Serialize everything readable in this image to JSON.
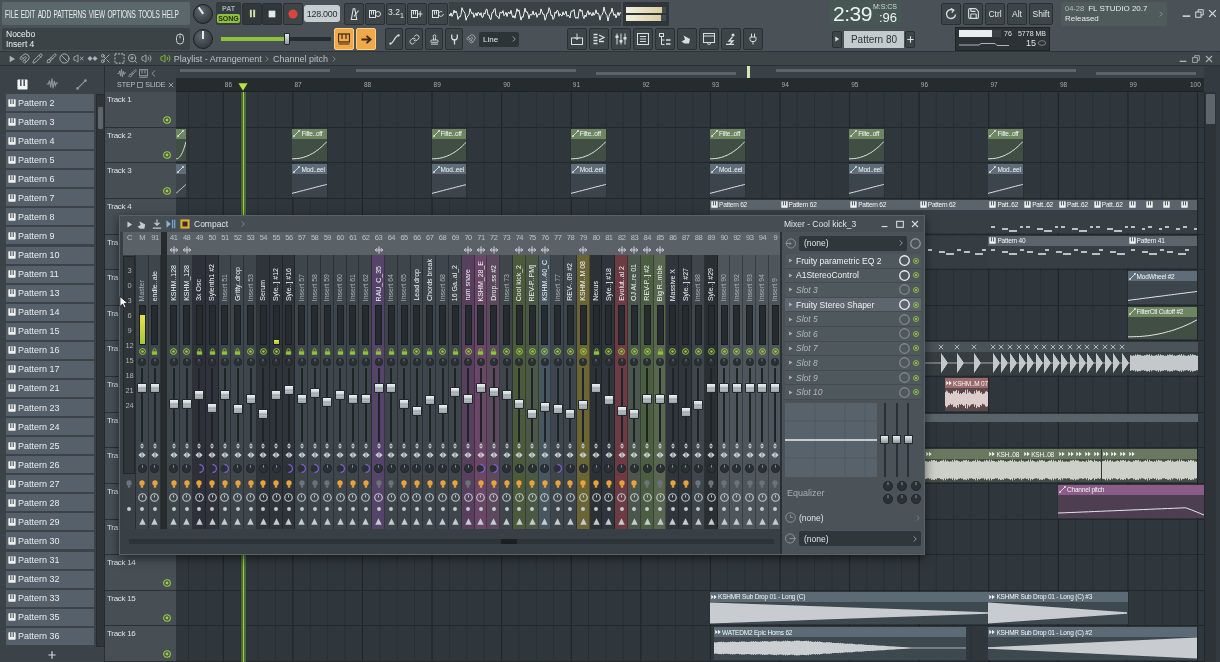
{
  "toolbar": {
    "menu": [
      "FILE",
      "EDIT",
      "ADD",
      "PATTERNS",
      "VIEW",
      "OPTIONS",
      "TOOLS",
      "HELP"
    ],
    "modes": [
      {
        "label": "PAT",
        "selected": false
      },
      {
        "label": "SONG",
        "selected": true
      }
    ],
    "playing": true,
    "recording": false,
    "tempo": "128.000",
    "countdown": "3.2$_{1}$",
    "output": [
      {
        "level": 0.9
      },
      {
        "level": 0.88
      }
    ],
    "time": "2:39",
    "time_sub": ":96",
    "time_unit": "M:S:CS",
    "keys": [
      "Ctrl",
      "Alt",
      "Shift"
    ],
    "news": {
      "date": "04-28",
      "title": "FL STUDIO 20.7",
      "text": "Released"
    },
    "hint": {
      "title": "Nocebo",
      "text": "Insert 4"
    },
    "slider": {
      "level": 0.6
    },
    "toggles": [
      {
        "kind": "keys",
        "on": true
      },
      {
        "kind": "arrow",
        "on": true
      }
    ],
    "snap": "Line",
    "pattern": "Pattern 80",
    "cpu": {
      "level": 0.78,
      "value": "76",
      "memory": "5778 MB",
      "polyphony": "15"
    }
  },
  "playlist": {
    "title": "Playlist - Arrangement",
    "clip": "Channel pitch",
    "picker_tabs": [
      {
        "kind": "patterns",
        "selected": true
      },
      {
        "kind": "audio",
        "selected": false
      },
      {
        "kind": "automation",
        "selected": false
      }
    ],
    "patterns": [
      "Pattern 2",
      "Pattern 3",
      "Pattern 4",
      "Pattern 5",
      "Pattern 6",
      "Pattern 7",
      "Pattern 8",
      "Pattern 9",
      "Pattern 10",
      "Pattern 11",
      "Pattern 13",
      "Pattern 14",
      "Pattern 15",
      "Pattern 16",
      "Pattern 17",
      "Pattern 21",
      "Pattern 23",
      "Pattern 24",
      "Pattern 25",
      "Pattern 26",
      "Pattern 27",
      "Pattern 28",
      "Pattern 29",
      "Pattern 30",
      "Pattern 31",
      "Pattern 32",
      "Pattern 33",
      "Pattern 35",
      "Pattern 36"
    ],
    "step": "STEP",
    "slide": "SLIDE",
    "bars": [
      "86",
      "87",
      "88",
      "89",
      "90",
      "91",
      "92",
      "93",
      "94",
      "95",
      "96",
      "97",
      "98",
      "99",
      "100"
    ],
    "tracks": [
      {
        "name": "Track 1",
        "enabled": true
      },
      {
        "name": "Track 2",
        "enabled": true,
        "clips": [
          {
            "kind": "automation",
            "color": "#6e8562"
          },
          {
            "kind": "automation",
            "label": "Filte..off",
            "color": "#6e8562"
          },
          {
            "kind": "automation",
            "label": "Filte..off",
            "color": "#6e8562"
          },
          {
            "kind": "automation",
            "label": "Filte..off",
            "color": "#6e8562"
          },
          {
            "kind": "automation",
            "label": "Filte..off",
            "color": "#6e8562"
          },
          {
            "kind": "automation",
            "label": "Filte..off",
            "color": "#6e8562"
          },
          {
            "kind": "automation",
            "label": "Filte..off",
            "color": "#6e8562"
          }
        ]
      },
      {
        "name": "Track 3",
        "enabled": true,
        "clips": [
          {
            "kind": "automation",
            "color": "#5f6d7a"
          },
          {
            "kind": "automation",
            "label": "Mod..eel",
            "color": "#5f6d7a"
          },
          {
            "kind": "automation",
            "label": "Mod..eel",
            "color": "#5f6d7a"
          },
          {
            "kind": "automation",
            "label": "Mod..eel",
            "color": "#5f6d7a"
          },
          {
            "kind": "automation",
            "label": "Mod..eel",
            "color": "#5f6d7a"
          },
          {
            "kind": "automation",
            "label": "Mod..eel",
            "color": "#5f6d7a"
          },
          {
            "kind": "automation",
            "label": "Mod..eel",
            "color": "#5f6d7a"
          }
        ]
      },
      {
        "name": "Track 4",
        "clips": [
          {
            "kind": "pattern",
            "label": "Pattern 62",
            "color": "#5b646b"
          },
          {
            "kind": "pattern",
            "label": "Pattern 62",
            "color": "#5b646b"
          },
          {
            "kind": "pattern",
            "label": "Pattern 62",
            "color": "#5b646b"
          },
          {
            "kind": "pattern",
            "label": "Pattern 62",
            "color": "#5b646b"
          },
          {
            "kind": "pattern",
            "label": "Patt..62",
            "color": "#5b646b"
          },
          {
            "kind": "pattern",
            "label": "Patt..62",
            "color": "#5b646b"
          },
          {
            "kind": "pattern",
            "label": "Patt..62",
            "color": "#5b646b"
          },
          {
            "kind": "pattern",
            "label": "Patt..62",
            "color": "#5b646b"
          },
          {
            "kind": "pattern",
            "color": "#5b646b"
          },
          {
            "kind": "pattern",
            "color": "#5b646b"
          },
          {
            "kind": "pattern",
            "color": "#5b646b"
          },
          {
            "kind": "pattern",
            "color": "#5b646b"
          }
        ]
      },
      {
        "name": "Tra",
        "clips": [
          {
            "kind": "notes"
          },
          {
            "kind": "pattern",
            "label": "Pattern 40",
            "color": "#5b646b"
          },
          {
            "kind": "pattern",
            "label": "Pattern 41",
            "color": "#5b646b"
          }
        ]
      },
      {
        "name": "Tra",
        "clips": [
          {
            "kind": "automation",
            "label": "ModWheel #2",
            "color": "#5f6d7a"
          }
        ]
      },
      {
        "name": "Tra",
        "clips": [
          {
            "kind": "automation",
            "label": "FilterCtl Cutoff #2",
            "color": "#6e8562"
          }
        ]
      },
      {
        "name": "Tra",
        "clips": [
          {
            "kind": "sliced",
            "color": "#4a5358"
          }
        ]
      },
      {
        "name": "Tra",
        "clips": [
          {
            "kind": "audio",
            "label": "KSHM..M 07",
            "color": "#9c6a6a"
          }
        ]
      },
      {
        "name": "Tra",
        "clips": [
          {
            "kind": "block",
            "color": "#59636a"
          }
        ]
      },
      {
        "name": "Tra",
        "clips": [
          {
            "kind": "audio",
            "color": "#6b775f"
          },
          {
            "kind": "audio",
            "label": "KSH..08",
            "color": "#6b775f"
          },
          {
            "kind": "audio",
            "label": "KSH..08",
            "color": "#6b775f"
          },
          {
            "kind": "audio",
            "color": "#6b775f"
          },
          {
            "kind": "audio",
            "color": "#6b775f"
          },
          {
            "kind": "audio",
            "color": "#6b775f"
          },
          {
            "kind": "audio",
            "color": "#6b775f"
          },
          {
            "kind": "audio",
            "color": "#6b775f"
          },
          {
            "kind": "audio",
            "color": "#6b775f"
          },
          {
            "kind": "audio",
            "color": "#6b775f"
          },
          {
            "kind": "audio",
            "color": "#6b775f"
          },
          {
            "kind": "audio",
            "color": "#6b775f"
          }
        ]
      },
      {
        "name": "Tra",
        "clips": [
          {
            "kind": "automation",
            "label": "Channel pitch",
            "color": "#8c5c88"
          }
        ]
      },
      {
        "name": "Tra"
      },
      {
        "name": "Track 14",
        "enabled": true
      },
      {
        "name": "Track 15",
        "enabled": true,
        "clips": [
          {
            "kind": "audio",
            "label": "KSHMR Sub Drop 01 - Long (C)",
            "color": "#5b6a74"
          },
          {
            "kind": "audio",
            "label": "KSHMR Sub Drop 01 - Long (C) #3",
            "color": "#5b6a74"
          }
        ]
      },
      {
        "name": "Track 16",
        "enabled": true,
        "clips": [
          {
            "kind": "audio",
            "label": "WATEDM2 Epic Horns 62",
            "color": "#5b6a74"
          },
          {
            "kind": "audio",
            "label": "KSHMR Sub Drop 01 - Long (C) #2",
            "color": "#5b6a74"
          }
        ]
      }
    ]
  },
  "mixer": {
    "view": "Compact",
    "scale": [
      "3",
      "0",
      "3",
      "6",
      "9",
      "12",
      "15",
      "18",
      "21",
      "24"
    ],
    "strips": [
      {
        "kind": "scale",
        "number": "C"
      },
      {
        "kind": "insert",
        "number": "M",
        "name": "Master",
        "empty": true,
        "send": false,
        "locked": false,
        "level": 0.76,
        "sep": false,
        "route": true,
        "meter": {
          "level": 0.75
        }
      },
      {
        "kind": "insert",
        "number": "91",
        "name": "endle..ale",
        "empty": false,
        "send": false,
        "locked": true,
        "level": 0.76,
        "sep": false,
        "route": true
      },
      {
        "kind": "insert",
        "number": "41",
        "name": "KSHM..128",
        "empty": false,
        "send": true,
        "locked": false,
        "level": 0.52,
        "sep": false,
        "route": true
      },
      {
        "kind": "insert",
        "number": "48",
        "name": "KSHM_128",
        "empty": false,
        "send": true,
        "locked": false,
        "level": 0.52,
        "sep": false,
        "route": true
      },
      {
        "kind": "insert",
        "number": "49",
        "name": "3x Osc",
        "empty": false,
        "send": false,
        "locked": true,
        "level": 0.66,
        "sep": true,
        "route": true,
        "color": "#2e3039"
      },
      {
        "kind": "insert",
        "number": "50",
        "name": "Sylenth1 #2",
        "empty": false,
        "send": false,
        "locked": true,
        "level": 0.46,
        "sep": true,
        "route": true,
        "color": "#30333b"
      },
      {
        "kind": "insert",
        "number": "51",
        "name": "Insert 51",
        "empty": true,
        "send": false,
        "locked": true,
        "level": 0.66,
        "sep": true,
        "route": true
      },
      {
        "kind": "insert",
        "number": "52",
        "name": "Gritty..drop",
        "empty": false,
        "send": false,
        "locked": true,
        "level": 0.44,
        "sep": false,
        "route": true
      },
      {
        "kind": "insert",
        "number": "53",
        "name": "Insert 53",
        "empty": true,
        "send": false,
        "locked": false,
        "level": 0.6,
        "sep": false,
        "route": true
      },
      {
        "kind": "insert",
        "number": "54",
        "name": "Serum",
        "empty": false,
        "send": false,
        "locked": false,
        "level": 0.36,
        "sep": false,
        "route": true,
        "color": "#2f343a"
      },
      {
        "kind": "insert",
        "number": "55",
        "name": "Syle..] #12",
        "empty": false,
        "send": false,
        "locked": false,
        "level": 0.65,
        "sep": false,
        "route": true,
        "color": "#2f343a",
        "meter": {
          "level": 0.1
        }
      },
      {
        "kind": "insert",
        "number": "56",
        "name": "Syle..] #16",
        "empty": false,
        "send": false,
        "locked": true,
        "level": 0.74,
        "sep": true,
        "route": true,
        "color": "#2f343a"
      },
      {
        "kind": "insert",
        "number": "57",
        "name": "Insert 57",
        "empty": true,
        "send": false,
        "locked": true,
        "level": 0.59,
        "sep": true,
        "route": false
      },
      {
        "kind": "insert",
        "number": "58",
        "name": "Insert 58",
        "empty": true,
        "send": false,
        "locked": true,
        "level": 0.68,
        "sep": true,
        "route": false
      },
      {
        "kind": "insert",
        "number": "59",
        "name": "Insert 59",
        "empty": true,
        "send": false,
        "locked": true,
        "level": 0.55,
        "sep": false,
        "route": false
      },
      {
        "kind": "insert",
        "number": "60",
        "name": "Insert 60",
        "empty": true,
        "send": false,
        "locked": true,
        "level": 0.66,
        "sep": true,
        "route": true
      },
      {
        "kind": "insert",
        "number": "61",
        "name": "Insert 61",
        "empty": true,
        "send": false,
        "locked": true,
        "level": 0.6,
        "sep": false,
        "route": true
      },
      {
        "kind": "insert",
        "number": "62",
        "name": "Insert 62",
        "empty": true,
        "send": false,
        "locked": true,
        "level": 0.6,
        "sep": true,
        "route": true
      },
      {
        "kind": "insert",
        "number": "63",
        "name": "RAU_C_35",
        "empty": false,
        "send": true,
        "locked": true,
        "level": 0.76,
        "sep": false,
        "route": false,
        "color": "#56436a"
      },
      {
        "kind": "insert",
        "number": "64",
        "name": "Insert 64",
        "empty": true,
        "send": false,
        "locked": true,
        "level": 0.76,
        "sep": false,
        "route": false
      },
      {
        "kind": "insert",
        "number": "65",
        "name": "Insert 65",
        "empty": true,
        "send": false,
        "locked": true,
        "level": 0.52,
        "sep": false,
        "route": true
      },
      {
        "kind": "insert",
        "number": "66",
        "name": "Lead drop",
        "empty": false,
        "send": false,
        "locked": false,
        "level": 0.41,
        "sep": false,
        "route": true
      },
      {
        "kind": "insert",
        "number": "67",
        "name": "Chords break",
        "empty": false,
        "send": false,
        "locked": true,
        "level": 0.58,
        "sep": false,
        "route": true
      },
      {
        "kind": "insert",
        "number": "68",
        "name": "Insert 68",
        "empty": true,
        "send": false,
        "locked": false,
        "level": 0.44,
        "sep": false,
        "route": true
      },
      {
        "kind": "insert",
        "number": "69",
        "name": "16 Ga..al_2",
        "empty": false,
        "send": false,
        "locked": true,
        "level": 0.71,
        "sep": false,
        "route": true
      },
      {
        "kind": "insert",
        "number": "70",
        "name": "rum snare",
        "empty": false,
        "send": true,
        "locked": false,
        "level": 0.6,
        "sep": false,
        "route": false,
        "color": "#583f5d"
      },
      {
        "kind": "insert",
        "number": "71",
        "name": "KSHM_28_E",
        "empty": false,
        "send": true,
        "locked": true,
        "level": 0.76,
        "sep": true,
        "route": true,
        "color": "#6a4767"
      },
      {
        "kind": "insert",
        "number": "72",
        "name": "Drop..ss #2",
        "empty": false,
        "send": true,
        "locked": true,
        "level": 0.71,
        "sep": true,
        "route": true,
        "color": "#5b4a5d"
      },
      {
        "kind": "insert",
        "number": "73",
        "name": "Insert 73",
        "empty": true,
        "send": false,
        "locked": false,
        "level": 0.66,
        "sep": false,
        "route": true
      },
      {
        "kind": "insert",
        "number": "74",
        "name": "Cool kick_2",
        "empty": false,
        "send": true,
        "locked": false,
        "level": 0.52,
        "sep": false,
        "route": true,
        "color": "#4a5a3b"
      },
      {
        "kind": "insert",
        "number": "75",
        "name": "REV-P..PM]",
        "empty": false,
        "send": true,
        "locked": false,
        "level": 0.36,
        "sep": false,
        "route": true,
        "color": "#4a5845"
      },
      {
        "kind": "insert",
        "number": "76",
        "name": "KSHM..40_C",
        "empty": false,
        "send": true,
        "locked": false,
        "level": 0.47,
        "sep": false,
        "route": true,
        "color": "#475661"
      },
      {
        "kind": "insert",
        "number": "77",
        "name": "Insert 77",
        "empty": true,
        "send": false,
        "locked": false,
        "level": 0.44,
        "sep": true,
        "route": true
      },
      {
        "kind": "insert",
        "number": "78",
        "name": "REV-..09 #2",
        "empty": false,
        "send": false,
        "locked": false,
        "level": 0.36,
        "sep": false,
        "route": true
      },
      {
        "kind": "insert",
        "number": "79",
        "name": "KSHM..M 08",
        "empty": false,
        "send": true,
        "locked": false,
        "level": 0.5,
        "sep": false,
        "route": true,
        "color": "#6b6536"
      },
      {
        "kind": "insert",
        "number": "80",
        "name": "Nexus",
        "empty": false,
        "send": false,
        "locked": true,
        "level": 0.76,
        "sep": false,
        "route": true,
        "color": "#2c3136"
      },
      {
        "kind": "insert",
        "number": "81",
        "name": "Syle..] #18",
        "empty": false,
        "send": false,
        "locked": false,
        "level": 0.58,
        "sep": false,
        "route": true,
        "color": "#2f353a"
      },
      {
        "kind": "insert",
        "number": "82",
        "name": "Evolut..al 2",
        "empty": false,
        "send": true,
        "locked": false,
        "level": 0.41,
        "sep": false,
        "route": true,
        "color": "#6c3b43"
      },
      {
        "kind": "insert",
        "number": "83",
        "name": "OJ At..re 01",
        "empty": false,
        "send": true,
        "locked": false,
        "level": 0.36,
        "sep": false,
        "route": true,
        "color": "#4b564e"
      },
      {
        "kind": "insert",
        "number": "84",
        "name": "REV-P..] #2",
        "empty": false,
        "send": true,
        "locked": false,
        "level": 0.6,
        "sep": false,
        "route": false,
        "color": "#4c5e42"
      },
      {
        "kind": "insert",
        "number": "85",
        "name": "Big R..mble",
        "empty": false,
        "send": true,
        "locked": true,
        "level": 0.6,
        "sep": false,
        "route": false,
        "color": "#5a6650"
      },
      {
        "kind": "insert",
        "number": "86",
        "name": "Massive X",
        "empty": false,
        "send": false,
        "locked": false,
        "level": 0.6,
        "sep": false,
        "route": true,
        "color": "#2f353a"
      },
      {
        "kind": "insert",
        "number": "87",
        "name": "Syle..] #27",
        "empty": false,
        "send": false,
        "locked": false,
        "level": 0.39,
        "sep": false,
        "route": true,
        "color": "#2f353a"
      },
      {
        "kind": "insert",
        "number": "88",
        "name": "Insert 88",
        "empty": true,
        "send": false,
        "locked": false,
        "level": 0.5,
        "sep": false,
        "route": false
      },
      {
        "kind": "insert",
        "number": "89",
        "name": "Syle..] #29",
        "empty": false,
        "send": false,
        "locked": false,
        "level": 0.76,
        "sep": false,
        "route": false,
        "color": "#2a2f33"
      },
      {
        "kind": "insert",
        "number": "90",
        "name": "Insert 90",
        "empty": true,
        "send": false,
        "locked": false,
        "level": 0.76,
        "sep": false,
        "route": false,
        "color": "#4e565c"
      },
      {
        "kind": "insert",
        "number": "92",
        "name": "Insert 92",
        "empty": true,
        "send": false,
        "locked": false,
        "level": 0.76,
        "sep": false,
        "route": false,
        "color": "#4e565c"
      },
      {
        "kind": "insert",
        "number": "93",
        "name": "Insert 93",
        "empty": true,
        "send": false,
        "locked": false,
        "level": 0.76,
        "sep": false,
        "route": false,
        "color": "#4e565c"
      },
      {
        "kind": "insert",
        "number": "94",
        "name": "Insert 94",
        "empty": true,
        "send": false,
        "locked": false,
        "level": 0.76,
        "sep": false,
        "route": false,
        "color": "#4e565c"
      },
      {
        "kind": "insert",
        "number": "9",
        "name": "Insert 9",
        "empty": true,
        "send": false,
        "locked": false,
        "level": 0.76,
        "sep": false,
        "route": false,
        "color": "#4e565c"
      }
    ],
    "panel": {
      "title": "Mixer - Cool kick_3",
      "input": "(none)",
      "slots": [
        {
          "name": "Fruity parametric EQ 2",
          "empty": false,
          "selected": false
        },
        {
          "name": "A1StereoControl",
          "empty": false,
          "selected": false
        },
        {
          "name": "Slot 3",
          "empty": true,
          "selected": false
        },
        {
          "name": "Fruity Stereo Shaper",
          "empty": false,
          "selected": true
        },
        {
          "name": "Slot 5",
          "empty": true,
          "selected": false
        },
        {
          "name": "Slot 6",
          "empty": true,
          "selected": false
        },
        {
          "name": "Slot 7",
          "empty": true,
          "selected": false
        },
        {
          "name": "Slot 8",
          "empty": true,
          "selected": false
        },
        {
          "name": "Slot 9",
          "empty": true,
          "selected": false
        },
        {
          "name": "Slot 10",
          "empty": true,
          "selected": false
        }
      ],
      "eq_label": "Equalizer",
      "eq_bands": [
        {
          "level": 0.5
        },
        {
          "level": 0.5
        },
        {
          "level": 0.5
        }
      ],
      "sidechain": "(none)",
      "output": "(none)"
    }
  }
}
